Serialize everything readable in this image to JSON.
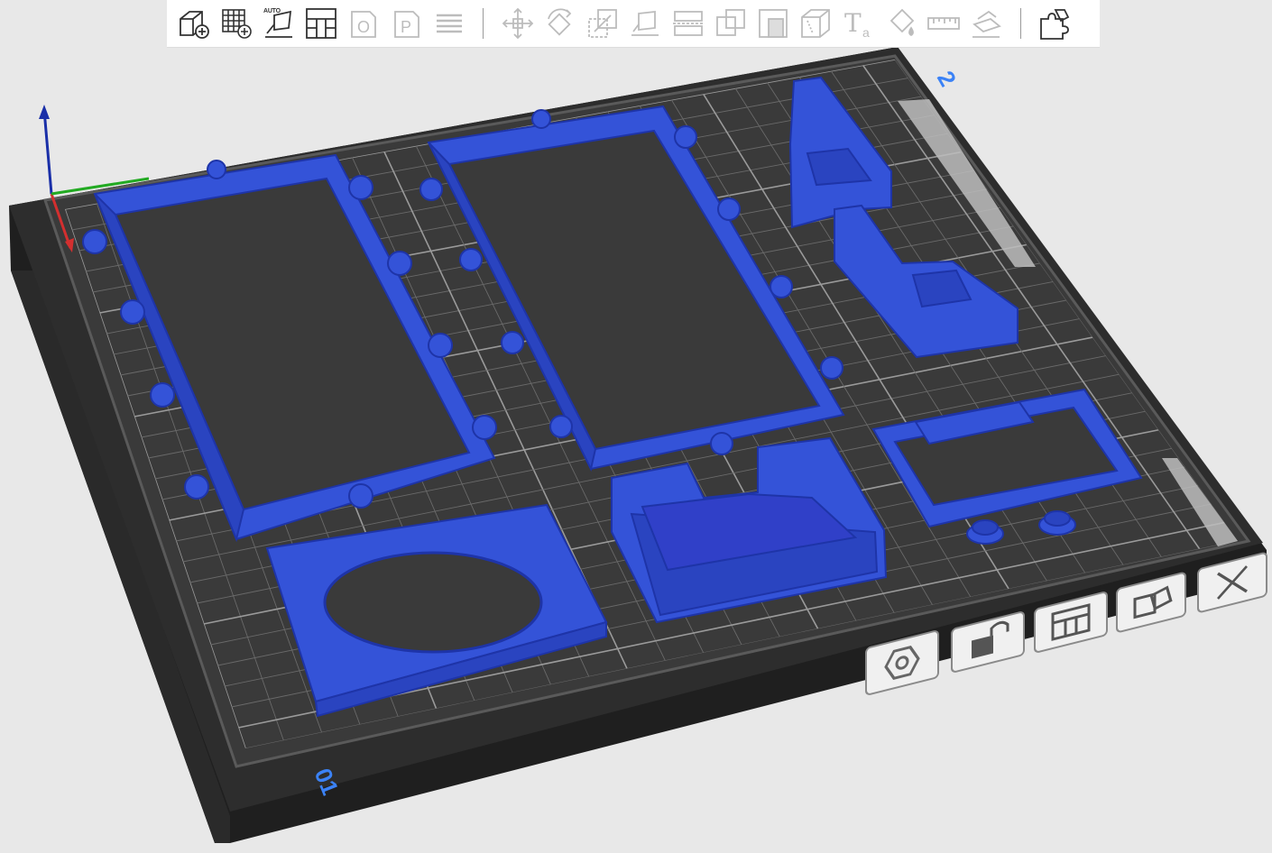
{
  "toolbar": {
    "buttons": [
      {
        "name": "add-object-button",
        "icon": "cube-plus-icon",
        "enabled": true
      },
      {
        "name": "add-plate-button",
        "icon": "grid-plus-icon",
        "enabled": true
      },
      {
        "name": "auto-orient-button",
        "icon": "auto-orient-icon",
        "label": "AUTO",
        "enabled": true
      },
      {
        "name": "arrange-button",
        "icon": "arrange-icon",
        "enabled": true
      },
      {
        "name": "split-objects-button",
        "icon": "split-objects-icon",
        "label": "O",
        "enabled": false
      },
      {
        "name": "split-parts-button",
        "icon": "split-parts-icon",
        "label": "P",
        "enabled": false
      },
      {
        "name": "layers-button",
        "icon": "layers-icon",
        "enabled": false
      },
      {
        "name": "move-button",
        "icon": "move-icon",
        "enabled": false
      },
      {
        "name": "rotate-button",
        "icon": "rotate-icon",
        "enabled": false
      },
      {
        "name": "scale-button",
        "icon": "scale-icon",
        "enabled": false
      },
      {
        "name": "lay-on-face-button",
        "icon": "lay-on-face-icon",
        "enabled": false
      },
      {
        "name": "cut-button",
        "icon": "cut-icon",
        "enabled": false
      },
      {
        "name": "boolean-button",
        "icon": "boolean-icon",
        "enabled": false
      },
      {
        "name": "support-paint-button",
        "icon": "support-paint-icon",
        "enabled": false
      },
      {
        "name": "seam-paint-button",
        "icon": "seam-paint-icon",
        "enabled": false
      },
      {
        "name": "text-button",
        "icon": "text-icon",
        "label": "T",
        "sublabel": "a",
        "enabled": false
      },
      {
        "name": "color-paint-button",
        "icon": "paint-bucket-icon",
        "enabled": false
      },
      {
        "name": "measure-button",
        "icon": "ruler-icon",
        "enabled": false
      },
      {
        "name": "assembly-button",
        "icon": "assembly-icon",
        "enabled": false
      },
      {
        "name": "assembly-view-button",
        "icon": "puzzle-icon",
        "enabled": true
      }
    ]
  },
  "plate": {
    "front_label": "01",
    "back_label": "2",
    "accent_color": "#3b82f6",
    "part_color": "#3453d8",
    "bed_color": "#3a3a3a",
    "grid_color": "#8a8a8a"
  },
  "plate_buttons": [
    {
      "name": "slice-plate-button",
      "icon": "hexagon-nut-icon"
    },
    {
      "name": "lock-plate-button",
      "icon": "unlock-icon"
    },
    {
      "name": "arrange-plate-button",
      "icon": "arrange-icon"
    },
    {
      "name": "plate-settings-button",
      "icon": "plate-settings-icon"
    },
    {
      "name": "delete-plate-button",
      "icon": "close-icon"
    }
  ],
  "axes": {
    "x_color": "#d32f2f",
    "y_color": "#22aa22",
    "z_color": "#1a2fa8"
  }
}
